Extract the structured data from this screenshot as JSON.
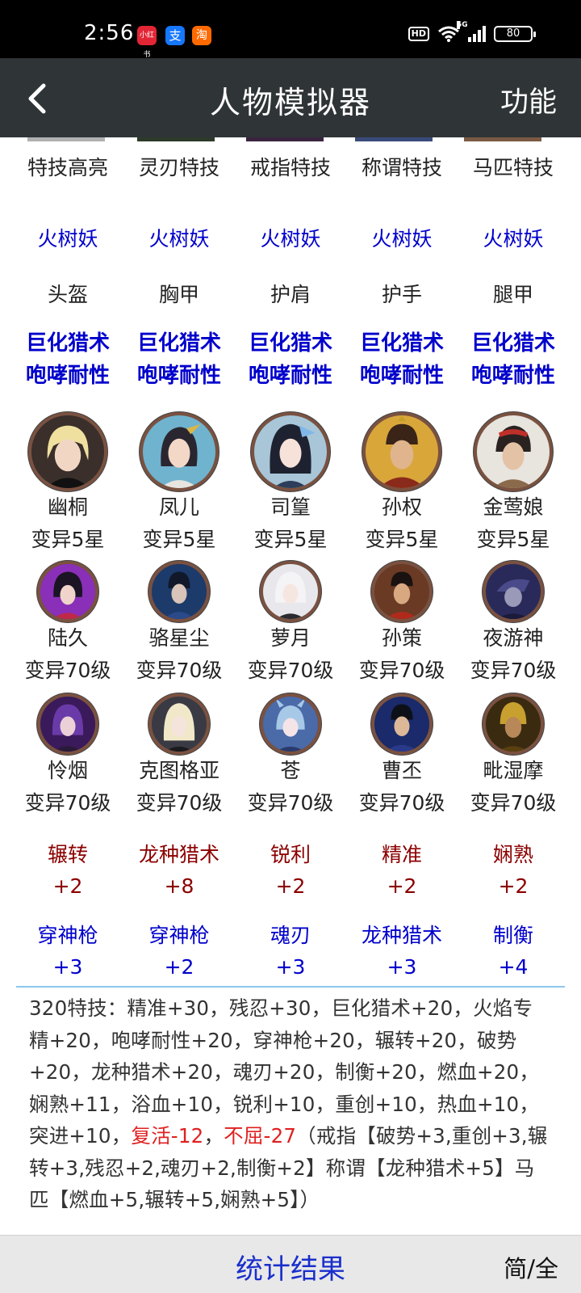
{
  "status_bar": {
    "time": "2:56",
    "notif_icons": [
      "小红书",
      "支",
      "淘"
    ],
    "hd": "HD",
    "network": "5G",
    "battery": "80"
  },
  "app_bar": {
    "title": "人物模拟器",
    "menu_label": "功能"
  },
  "special_skills": [
    "特技高亮",
    "灵刃特技",
    "戒指特技",
    "称谓特技",
    "马匹特技"
  ],
  "set_name": [
    "火树妖",
    "火树妖",
    "火树妖",
    "火树妖",
    "火树妖"
  ],
  "armor_slots": [
    {
      "slot": "头盔",
      "skill1": "巨化猎术",
      "skill2": "咆哮耐性"
    },
    {
      "slot": "胸甲",
      "skill1": "巨化猎术",
      "skill2": "咆哮耐性"
    },
    {
      "slot": "护肩",
      "skill1": "巨化猎术",
      "skill2": "咆哮耐性"
    },
    {
      "slot": "护手",
      "skill1": "巨化猎术",
      "skill2": "咆哮耐性"
    },
    {
      "slot": "腿甲",
      "skill1": "巨化猎术",
      "skill2": "咆哮耐性"
    }
  ],
  "main_heroes": [
    {
      "name": "幽桐",
      "level": "变异5星"
    },
    {
      "name": "凤儿",
      "level": "变异5星"
    },
    {
      "name": "司篁",
      "level": "变异5星"
    },
    {
      "name": "孙权",
      "level": "变异5星"
    },
    {
      "name": "金莺娘",
      "level": "变异5星"
    }
  ],
  "sub_heroes_row1": [
    {
      "name": "陆久",
      "level": "变异70级"
    },
    {
      "name": "骆星尘",
      "level": "变异70级"
    },
    {
      "name": "萝月",
      "level": "变异70级"
    },
    {
      "name": "孙策",
      "level": "变异70级"
    },
    {
      "name": "夜游神",
      "level": "变异70级"
    }
  ],
  "sub_heroes_row2": [
    {
      "name": "怜烟",
      "level": "变异70级"
    },
    {
      "name": "克图格亚",
      "level": "变异70级"
    },
    {
      "name": "苍",
      "level": "变异70级"
    },
    {
      "name": "曹丕",
      "level": "变异70级"
    },
    {
      "name": "毗湿摩",
      "level": "变异70级"
    }
  ],
  "bonus_row1": [
    {
      "skill": "辗转",
      "value": "+2"
    },
    {
      "skill": "龙种猎术",
      "value": "+8"
    },
    {
      "skill": "锐利",
      "value": "+2"
    },
    {
      "skill": "精准",
      "value": "+2"
    },
    {
      "skill": "娴熟",
      "value": "+2"
    }
  ],
  "bonus_row2": [
    {
      "skill": "穿神枪",
      "value": "+3"
    },
    {
      "skill": "穿神枪",
      "value": "+2"
    },
    {
      "skill": "魂刃",
      "value": "+3"
    },
    {
      "skill": "龙种猎术",
      "value": "+3"
    },
    {
      "skill": "制衡",
      "value": "+4"
    }
  ],
  "summary": {
    "part1": "320特技：精准+30，残忍+30，巨化猎术+20，火焰专精+20，咆哮耐性+20，穿神枪+20，辗转+20，破势+20，龙种猎术+20，魂刃+20，制衡+20，燃血+20，娴熟+11，浴血+10，锐利+10，重创+10，热血+10，突进+10，",
    "neg1": "复活-12",
    "sep": "，",
    "neg2": "不屈-27",
    "part2": "（戒指【破势+3,重创+3,辗转+3,残忍+2,魂刃+2,制衡+2】称谓【龙种猎术+5】马匹【燃血+5,辗转+5,娴熟+5】）"
  },
  "bottom_bar": {
    "stats_label": "统计结果",
    "toggle_label": "简/全"
  },
  "colors": {
    "app_bar_bg": "#2f3437",
    "blue_text": "#0000cc",
    "red_text": "#8b0000",
    "negative": "#e02020",
    "divider": "#8ec7ee"
  }
}
